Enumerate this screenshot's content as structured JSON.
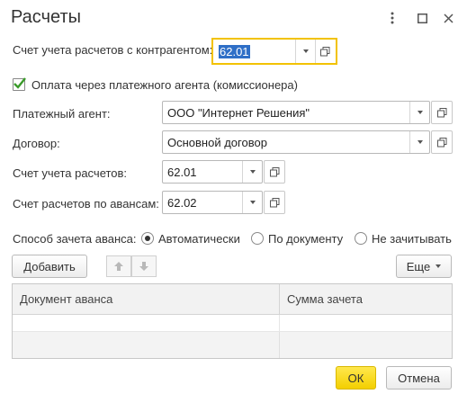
{
  "window": {
    "title": "Расчеты"
  },
  "form": {
    "counterparty_account_label": "Счет учета расчетов с контрагентом:",
    "counterparty_account_value": "62.01",
    "agent_checkbox_label": "Оплата через платежного агента (комиссионера)",
    "agent_checkbox_checked": true,
    "agent_label": "Платежный агент:",
    "agent_value": "ООО \"Интернет Решения\"",
    "contract_label": "Договор:",
    "contract_value": "Основной договор",
    "settlement_account_label": "Счет учета расчетов:",
    "settlement_account_value": "62.01",
    "advance_account_label": "Счет расчетов по авансам:",
    "advance_account_value": "62.02",
    "advance_offset_label": "Способ зачета аванса:",
    "advance_offset_options": [
      "Автоматически",
      "По документу",
      "Не зачитывать"
    ],
    "advance_offset_selected": "Автоматически"
  },
  "toolbar": {
    "add_label": "Добавить",
    "more_label": "Еще"
  },
  "table": {
    "columns": [
      "Документ аванса",
      "Сумма зачета"
    ],
    "rows": [
      [
        "",
        ""
      ],
      [
        "",
        ""
      ]
    ]
  },
  "footer": {
    "ok_label": "ОК",
    "cancel_label": "Отмена"
  },
  "colors": {
    "accent_yellow": "#f3cf00",
    "checkmark_green": "#3a9a2a",
    "selection_blue": "#2f6fc7"
  }
}
